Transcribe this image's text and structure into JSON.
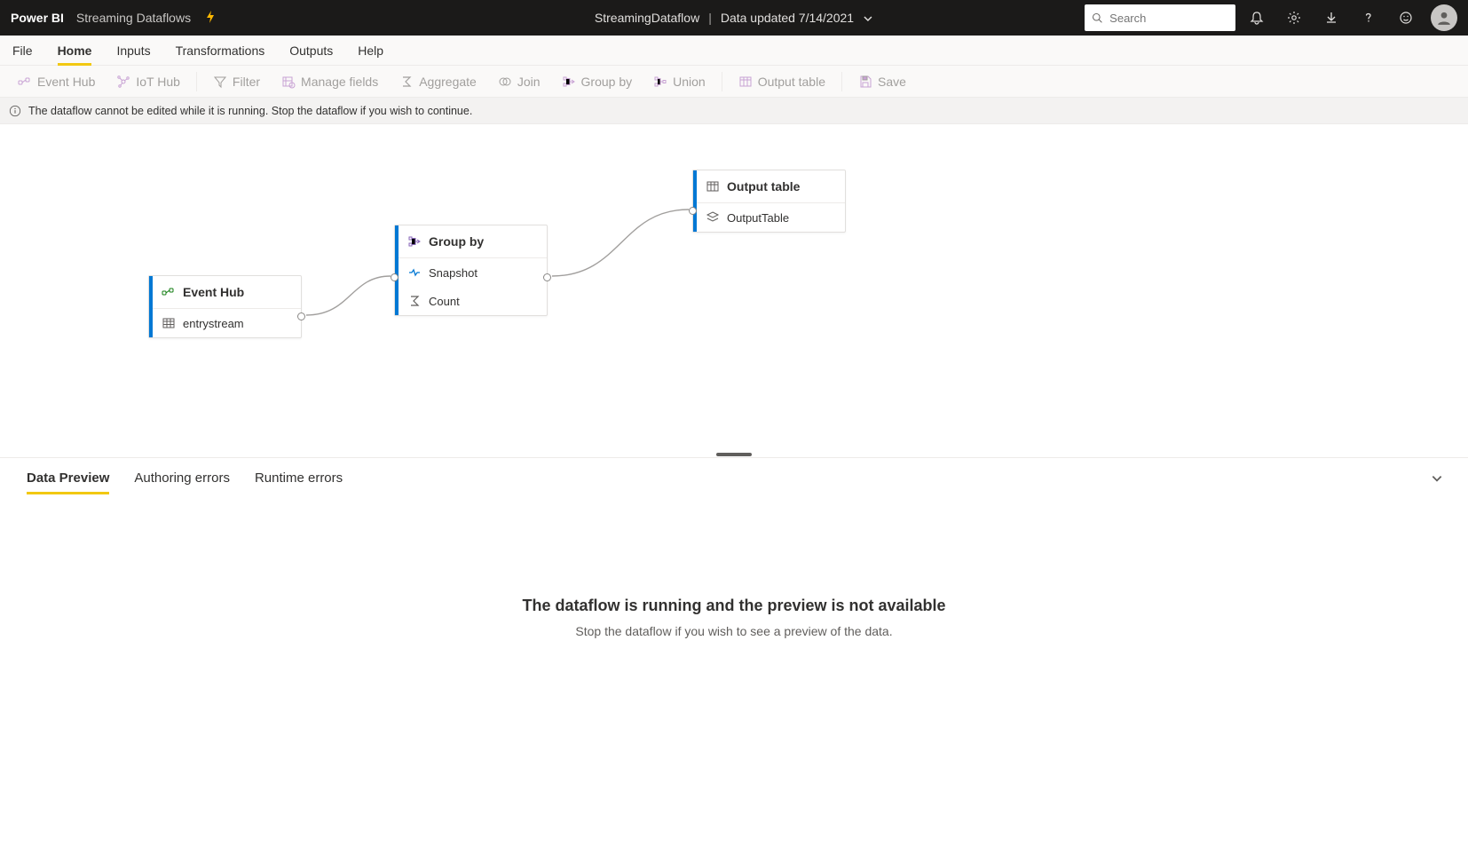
{
  "header": {
    "brand": "Power BI",
    "app": "Streaming Dataflows",
    "dataflow_name": "StreamingDataflow",
    "updated_label": "Data updated 7/14/2021",
    "search_placeholder": "Search"
  },
  "nav": {
    "items": [
      "File",
      "Home",
      "Inputs",
      "Transformations",
      "Outputs",
      "Help"
    ],
    "active": "Home"
  },
  "toolbar": {
    "event_hub": "Event Hub",
    "iot_hub": "IoT Hub",
    "filter": "Filter",
    "manage_fields": "Manage fields",
    "aggregate": "Aggregate",
    "join": "Join",
    "group_by": "Group by",
    "union": "Union",
    "output_table": "Output table",
    "save": "Save"
  },
  "banner": {
    "text": "The dataflow cannot be edited while it is running. Stop the dataflow if you wish to continue."
  },
  "nodes": {
    "event_hub": {
      "title": "Event Hub",
      "field": "entrystream"
    },
    "group_by": {
      "title": "Group by",
      "rows": [
        "Snapshot",
        "Count"
      ]
    },
    "output": {
      "title": "Output table",
      "field": "OutputTable"
    }
  },
  "bottom": {
    "tabs": [
      "Data Preview",
      "Authoring errors",
      "Runtime errors"
    ],
    "active": "Data Preview",
    "msg_title": "The dataflow is running and the preview is not available",
    "msg_sub": "Stop the dataflow if you wish to see a preview of the data."
  }
}
